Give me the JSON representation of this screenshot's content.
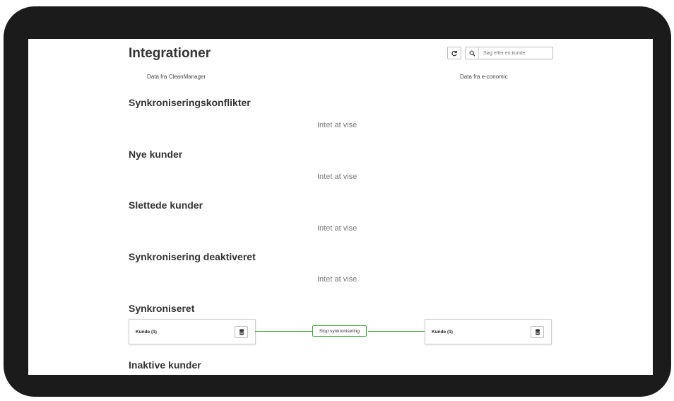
{
  "page": {
    "title": "Integrationer"
  },
  "toolbar": {
    "refresh_icon": "refresh-icon",
    "search_icon": "search-icon",
    "search_placeholder": "Søg efter en kunde"
  },
  "columns": {
    "left": "Data fra CleanManager",
    "right": "Data fra e-conomic"
  },
  "sections": [
    {
      "title": "Synkroniseringskonflikter",
      "empty_text": "Intet at vise"
    },
    {
      "title": "Nye kunder",
      "empty_text": "Intet at vise"
    },
    {
      "title": "Slettede kunder",
      "empty_text": "Intet at vise"
    },
    {
      "title": "Synkronisering deaktiveret",
      "empty_text": "Intet at vise"
    },
    {
      "title": "Synkroniseret"
    },
    {
      "title": "Inaktive kunder"
    }
  ],
  "synced": {
    "left_card_label": "Kunde (1)",
    "right_card_label": "Kunde (1)",
    "stop_button_label": "Stop synkronisering",
    "card_icon": "database-icon"
  },
  "colors": {
    "link_green": "#3d9a3d",
    "heading": "#333333",
    "muted": "#7a7a7a",
    "device_frame": "#1b1b1b"
  }
}
